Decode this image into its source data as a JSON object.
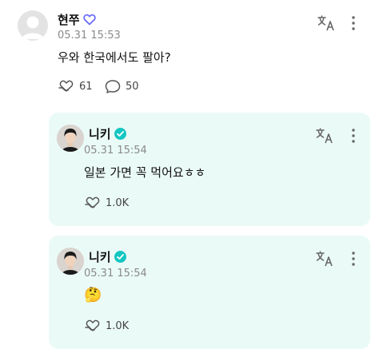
{
  "comment": {
    "author": "현쭈",
    "time": "05.31 15:53",
    "text": "우와 한국에서도 팔아?",
    "likes": "61",
    "replies": "50"
  },
  "replies": [
    {
      "author": "니키",
      "time": "05.31 15:54",
      "text": "일본 가면 꼭 먹어요ㅎㅎ",
      "likes": "1.0K"
    },
    {
      "author": "니키",
      "time": "05.31 15:54",
      "text": "🤔",
      "likes": "1.0K"
    }
  ],
  "icons": {
    "heart_badge": "heart-outline-icon",
    "translate": "translate-icon",
    "more": "more-vertical-icon",
    "like": "heart-hand-icon",
    "comment": "comment-bubble-icon",
    "verified": "verified-check-icon"
  },
  "colors": {
    "reply_card_bg": "#eafaf7",
    "verified": "#14c6c1",
    "heart_badge": "#6b6cff"
  }
}
